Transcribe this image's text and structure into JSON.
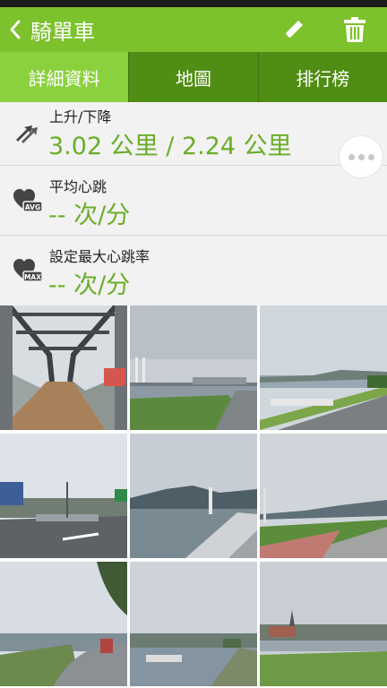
{
  "app_bar": {
    "title": "騎單車",
    "back_icon": "chevron-left-icon",
    "edit_icon": "pencil-icon",
    "delete_icon": "trash-icon"
  },
  "tabs": [
    {
      "label": "詳細資料",
      "active": true
    },
    {
      "label": "地圖",
      "active": false
    },
    {
      "label": "排行榜",
      "active": false
    }
  ],
  "stats": [
    {
      "label": "上升/下降",
      "value": "3.02 公里 / 2.24 公里",
      "icon": "ascent-descent-icon"
    },
    {
      "label": "平均心跳",
      "value": "-- 次/分",
      "icon": "heart-avg-icon",
      "badge": "AVG"
    },
    {
      "label": "設定最大心跳率",
      "value": "-- 次/分",
      "icon": "heart-max-icon",
      "badge": "MAX"
    }
  ],
  "more_icon": "more-icon",
  "colors": {
    "app_bar": "#7cc22c",
    "tab_bg": "#4f8d14",
    "tab_active": "#8bd13e",
    "value_green": "#6aad28"
  },
  "photos": [
    {
      "name": "bridge-walkway-photo"
    },
    {
      "name": "riverside-bridge-photo"
    },
    {
      "name": "bike-path-river-photo"
    },
    {
      "name": "road-intersection-photo"
    },
    {
      "name": "river-mountains-photo"
    },
    {
      "name": "bike-path-grass-photo"
    },
    {
      "name": "curved-path-photo"
    },
    {
      "name": "river-boats-photo"
    },
    {
      "name": "wetland-tower-photo"
    }
  ]
}
